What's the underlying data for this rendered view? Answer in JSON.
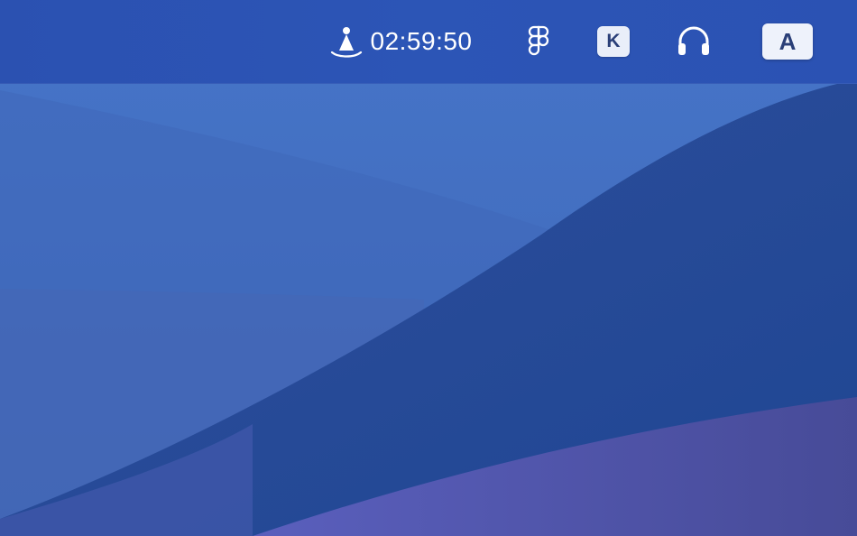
{
  "menubar": {
    "timer": {
      "icon": "timer-bell-icon",
      "value": "02:59:50"
    },
    "figma": {
      "icon": "figma-icon"
    },
    "k_app": {
      "label": "K"
    },
    "headphones": {
      "icon": "headphones-icon"
    },
    "input_source": {
      "label": "A"
    }
  },
  "colors": {
    "menubar": "#2c55b6",
    "wallpaper_light": "#4273c7",
    "wallpaper_dark": "#234a94",
    "wallpaper_purple": "#4a4f9f",
    "badge_background": "#eef2fb"
  }
}
